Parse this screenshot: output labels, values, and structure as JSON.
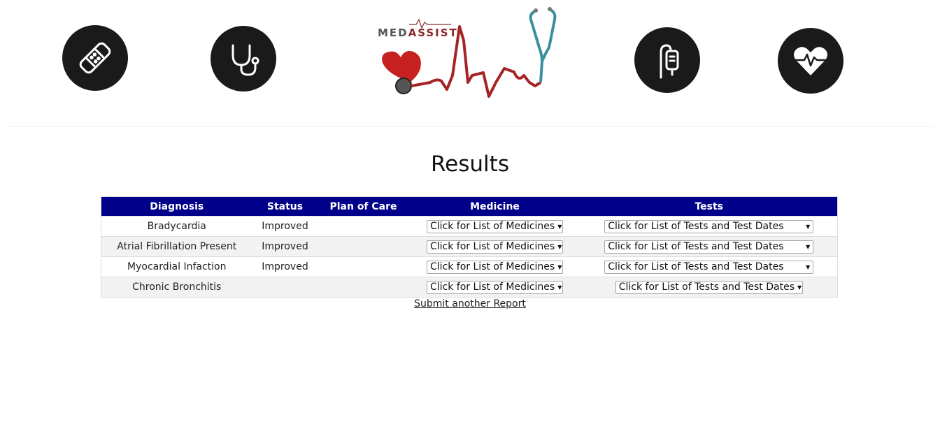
{
  "header": {
    "icons": [
      "bandage-icon",
      "stethoscope-icon",
      "iv-bag-icon",
      "heart-pulse-icon"
    ],
    "logo": {
      "part1": "MED",
      "part2": "ASSIST"
    }
  },
  "title": "Results",
  "table": {
    "headers": [
      "Diagnosis",
      "Status",
      "Plan of Care",
      "Medicine",
      "Tests"
    ],
    "rows": [
      {
        "diagnosis": "Bradycardia",
        "status": "Improved",
        "plan": "",
        "medicine": "Click for List of Medicines",
        "tests": "Click for List of Tests and Test Dates"
      },
      {
        "diagnosis": "Atrial Fibrillation Present",
        "status": "Improved",
        "plan": "",
        "medicine": "Click for List of Medicines",
        "tests": "Click for List of Tests and Test Dates"
      },
      {
        "diagnosis": "Myocardial Infaction",
        "status": "Improved",
        "plan": "",
        "medicine": "Click for List of Medicines",
        "tests": "Click for List of Tests and Test Dates"
      },
      {
        "diagnosis": "Chronic Bronchitis",
        "status": "",
        "plan": "",
        "medicine": "Click for List of Medicines",
        "tests": "Click for List of Tests and Test Dates"
      }
    ]
  },
  "submit_link": "Submit another Report",
  "colors": {
    "header_bg": "#00008b",
    "icon_bg": "#1a1a1a",
    "logo_red": "#8b2a2a",
    "alt_row": "#f2f2f2"
  }
}
